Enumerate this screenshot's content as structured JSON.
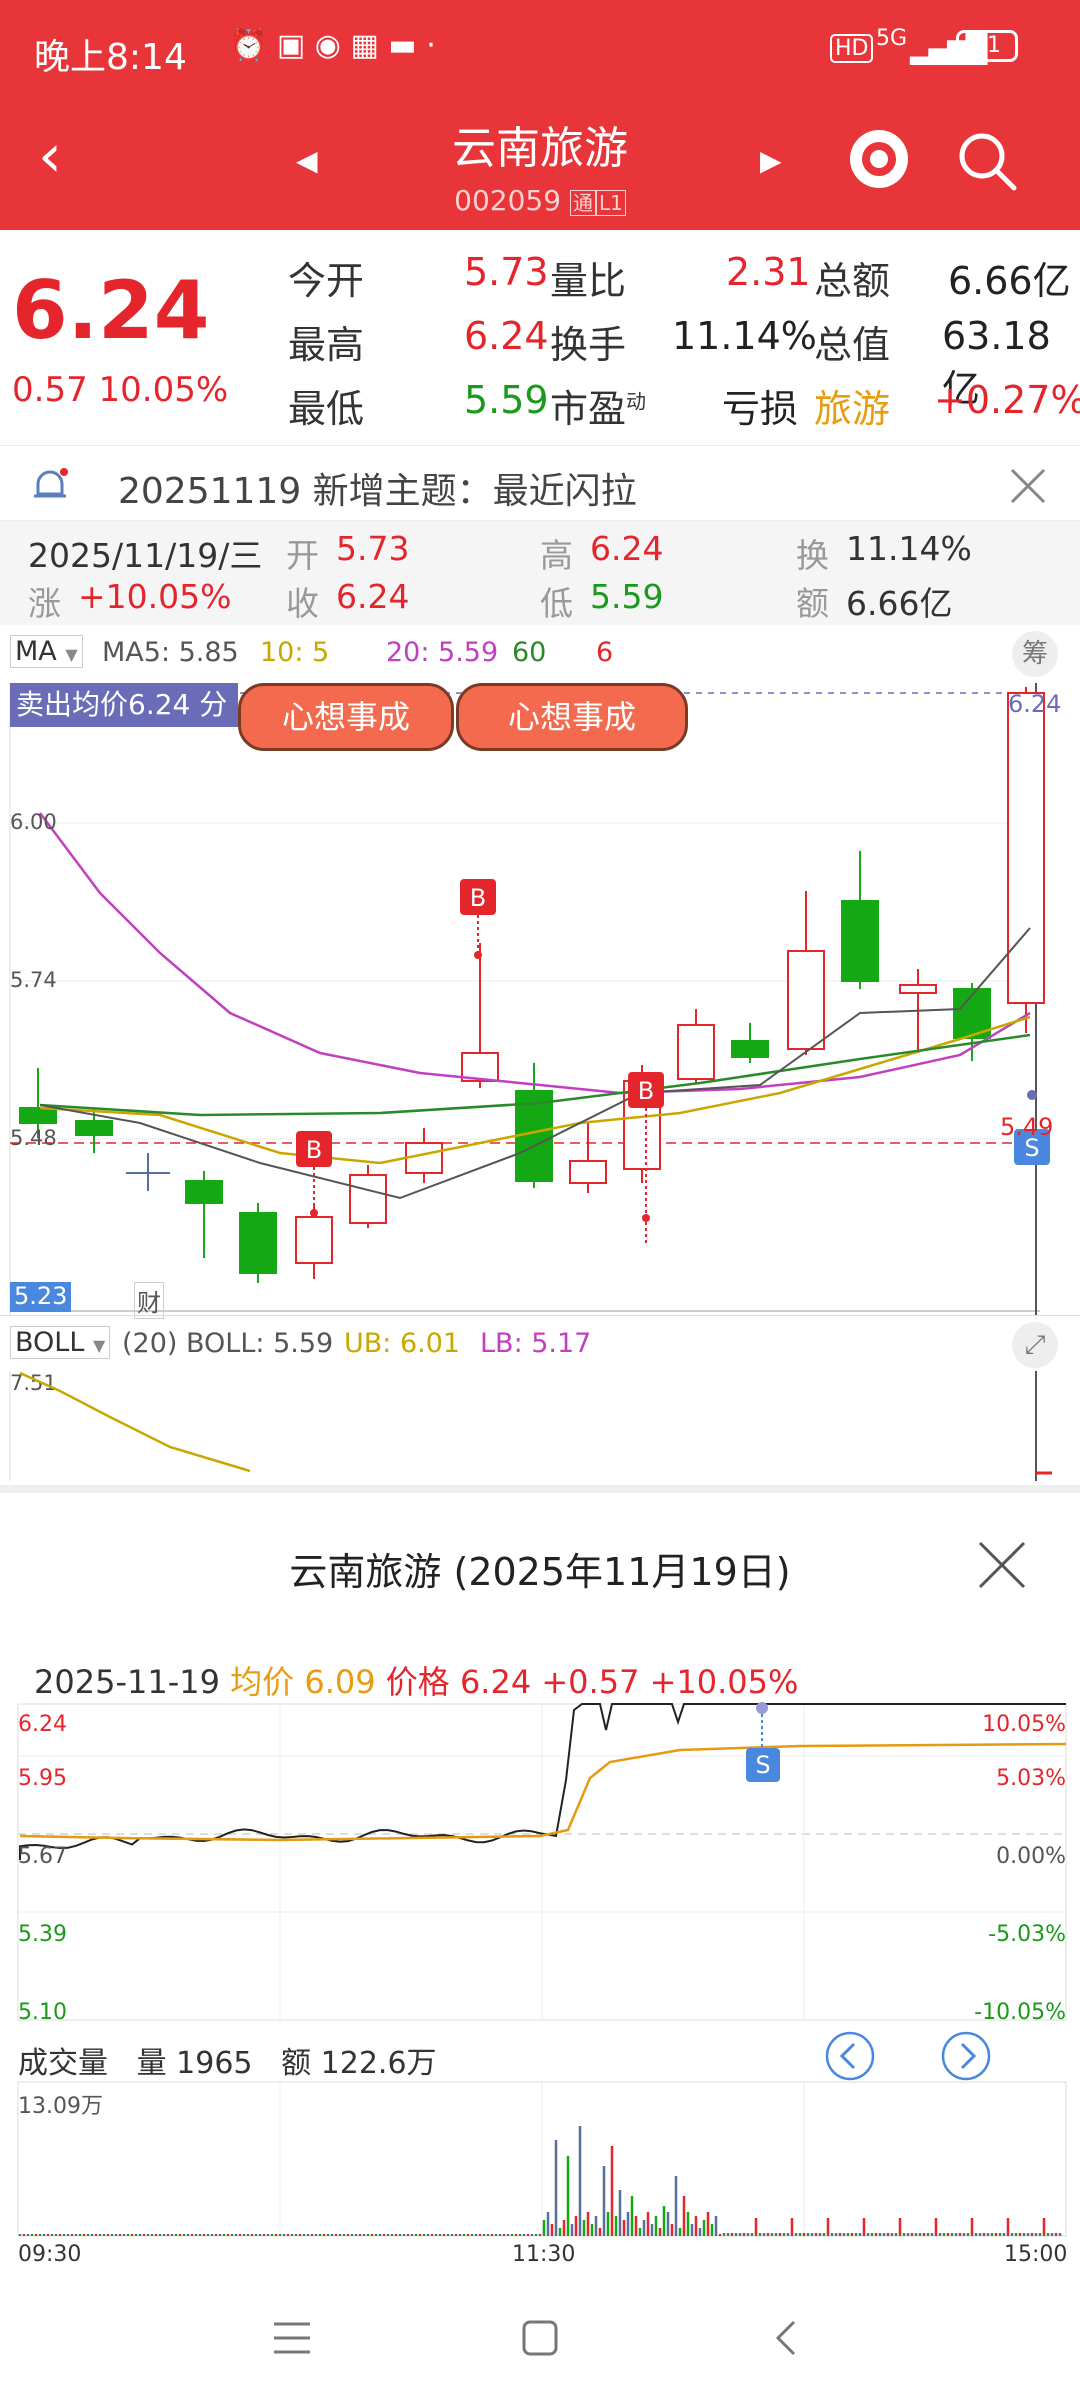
{
  "status": {
    "time": "晚上8:14",
    "network": "5G",
    "battery": "81"
  },
  "header": {
    "title": "云南旅游",
    "code": "002059",
    "badge1": "通",
    "badge2": "L1"
  },
  "quote": {
    "price": "6.24",
    "change": "0.57",
    "pct": "10.05%",
    "rows": [
      [
        {
          "k": "今开",
          "v": "5.73",
          "c": "red"
        },
        {
          "k": "量比",
          "v": "2.31",
          "c": "red"
        },
        {
          "k": "总额",
          "v": "6.66亿",
          "c": "dark"
        }
      ],
      [
        {
          "k": "最高",
          "v": "6.24",
          "c": "red"
        },
        {
          "k": "换手",
          "v": "11.14%",
          "c": "dark"
        },
        {
          "k": "总值",
          "v": "63.18亿",
          "c": "dark"
        }
      ],
      [
        {
          "k": "最低",
          "v": "5.59",
          "c": "green"
        },
        {
          "k": "市盈",
          "v": "亏损",
          "c": "dark",
          "sup": "动"
        },
        {
          "k": "旅游",
          "v": "+0.27%",
          "c": "red"
        }
      ]
    ]
  },
  "notice": {
    "text": "20251119 新增主题：最近闪拉"
  },
  "dayinfo": {
    "date": "2025/11/19/三",
    "open_k": "开",
    "open": "5.73",
    "high_k": "高",
    "high": "6.24",
    "turn_k": "换",
    "turn": "11.14%",
    "chg_k": "涨",
    "chg": "+10.05%",
    "close_k": "收",
    "close": "6.24",
    "low_k": "低",
    "low": "5.59",
    "amt_k": "额",
    "amt": "6.66亿"
  },
  "ma_bar": {
    "label": "MA",
    "ma5": "MA5: 5.85",
    "ma10": "10: 5",
    "ma20": "20: 5.59",
    "ma60": "60",
    "ma60b": "6",
    "chip_btn": "筹"
  },
  "kline": {
    "sell_avg": "卖出均价6.24 分",
    "sticker": "心想事成",
    "y_labels": [
      "6.00",
      "5.74",
      "5.48"
    ],
    "low_label": "5.23",
    "top_right": "6.24",
    "s_price": "5.49",
    "cai": "财",
    "b_marker": "B",
    "s_marker": "S"
  },
  "boll": {
    "label": "BOLL",
    "period": "(20) BOLL: 5.59",
    "ub": "UB: 6.01",
    "lb": "LB: 5.17",
    "y": "7.51"
  },
  "popup": {
    "title": "云南旅游 (2025年11月19日)",
    "date": "2025-11-19",
    "avg_k": "均价",
    "avg": "6.09",
    "price_k": "价格",
    "price": "6.24",
    "chg": "+0.57",
    "pct": "+10.05%",
    "left_axis": [
      "6.24",
      "5.95",
      "5.67",
      "5.39",
      "5.10"
    ],
    "right_axis": [
      "10.05%",
      "5.03%",
      "0.00%",
      "-5.03%",
      "-10.05%"
    ],
    "vol_label": "成交量",
    "vol": "量 1965",
    "amt": "额 122.6万",
    "vol_max": "13.09万",
    "times": [
      "09:30",
      "11:30",
      "15:00"
    ],
    "s_marker": "S"
  },
  "colors": {
    "brand": "#e8353a",
    "up": "#e4262c",
    "down": "#14a814",
    "ma5": "#333333",
    "ma10": "#c8a800",
    "ma20": "#c040c0",
    "ma60": "#2a8a2a",
    "avg": "#e59a10"
  }
}
